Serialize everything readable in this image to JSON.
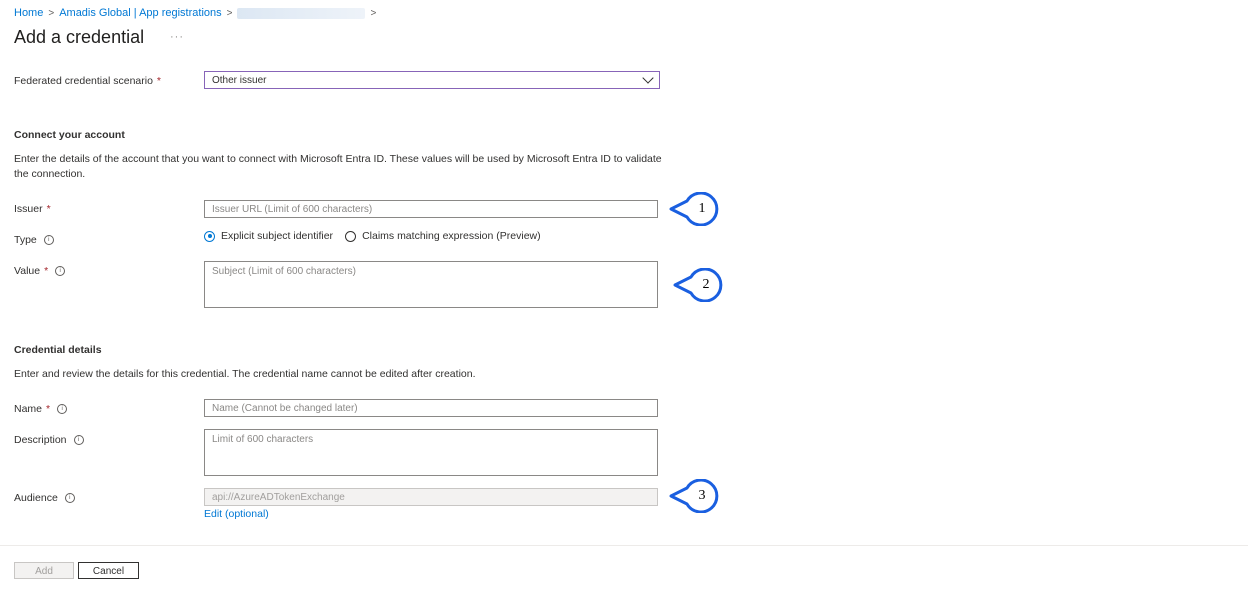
{
  "breadcrumb": {
    "home": "Home",
    "org": "Amadis Global | App registrations"
  },
  "page": {
    "title": "Add a credential",
    "more": "···"
  },
  "scenario": {
    "label": "Federated credential scenario",
    "required_mark": "*",
    "value": "Other issuer"
  },
  "connect": {
    "heading": "Connect your account",
    "description": "Enter the details of the account that you want to connect with Microsoft Entra ID. These values will be used by Microsoft Entra ID to validate the connection.",
    "issuer_label": "Issuer",
    "issuer_placeholder": "Issuer URL (Limit of 600 characters)",
    "type_label": "Type",
    "type_options": [
      "Explicit subject identifier",
      "Claims matching expression (Preview)"
    ],
    "type_selected": "Explicit subject identifier",
    "value_label": "Value",
    "value_placeholder": "Subject (Limit of 600 characters)"
  },
  "credential": {
    "heading": "Credential details",
    "description": "Enter and review the details for this credential. The credential name cannot be edited after creation.",
    "name_label": "Name",
    "name_placeholder": "Name (Cannot be changed later)",
    "description_label": "Description",
    "description_placeholder": "Limit of 600 characters",
    "audience_label": "Audience",
    "audience_value": "api://AzureADTokenExchange",
    "edit_link": "Edit (optional)"
  },
  "footer": {
    "add_label": "Add",
    "cancel_label": "Cancel"
  },
  "callouts": [
    "1",
    "2",
    "3"
  ],
  "icons": {
    "breadcrumb_separator": "chevron-right-icon",
    "info": "info-icon",
    "dropdown": "chevron-down-icon"
  },
  "colors": {
    "accent": "#0078d4",
    "required": "#a4262c",
    "select_border": "#8764b8",
    "callout": "#1a5fe0"
  }
}
